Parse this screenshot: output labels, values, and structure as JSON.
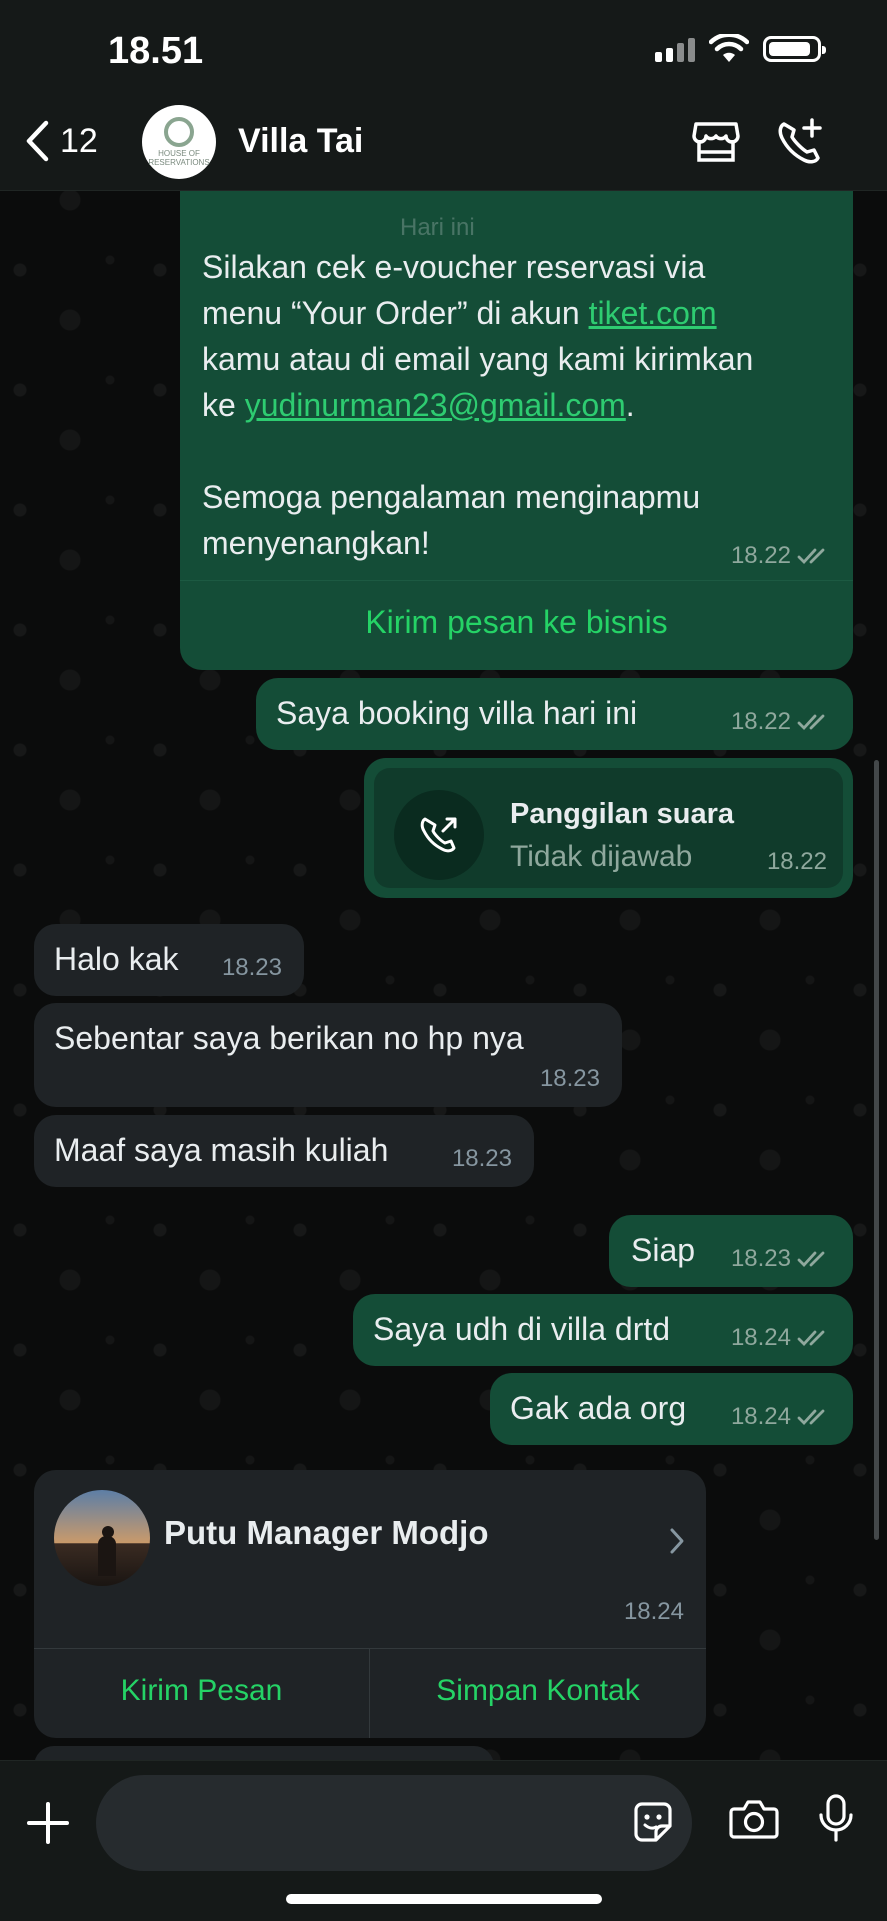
{
  "status_bar": {
    "time": "18.51"
  },
  "header": {
    "back_count": "12",
    "chat_title": "Villa Tai",
    "avatar_text": "HOUSE OF RESERVATIONS"
  },
  "messages": {
    "business": {
      "date_label": "Hari ini",
      "line1": "Silakan cek e-voucher reservasi via",
      "line2_pre": "menu “Your Order” di akun ",
      "line2_link": "tiket.com",
      "line3": "kamu atau di email yang kami kirimkan",
      "line4_pre": "ke ",
      "line4_link": "yudinurman23@gmail.com",
      "line4_post": ".",
      "line5": "Semoga pengalaman menginapmu",
      "line6": "menyenangkan!",
      "time": "18.22",
      "action": "Kirim pesan ke bisnis"
    },
    "m1": {
      "text": "Saya booking villa hari ini",
      "time": "18.22"
    },
    "call": {
      "title": "Panggilan suara",
      "subtitle": "Tidak dijawab",
      "time": "18.22"
    },
    "m2": {
      "text": "Halo kak",
      "time": "18.23"
    },
    "m3": {
      "text": "Sebentar saya berikan no hp nya",
      "time": "18.23"
    },
    "m4": {
      "text": "Maaf saya masih kuliah",
      "time": "18.23"
    },
    "m5": {
      "text": "Siap",
      "time": "18.23"
    },
    "m6": {
      "text": "Saya udh di villa drtd",
      "time": "18.24"
    },
    "m7": {
      "text": "Gak ada org",
      "time": "18.24"
    },
    "contact": {
      "name": "Putu Manager Modjo",
      "time": "18.24",
      "send_label": "Kirim Pesan",
      "save_label": "Simpan Kontak"
    }
  },
  "colors": {
    "outgoing_bubble": "#144d37",
    "incoming_bubble": "#1f2326",
    "accent_green": "#25d366"
  }
}
